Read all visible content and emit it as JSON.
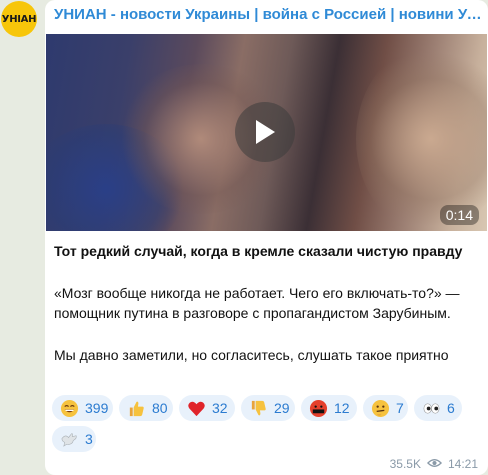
{
  "avatar": {
    "text": "УНІАН"
  },
  "channel": {
    "title": "УНИАН - новости Украины | война с Россией | новини України..."
  },
  "video": {
    "duration": "0:14"
  },
  "message": {
    "title": "Тот редкий случай, когда в кремле сказали чистую правду",
    "quote": "«Мозг вообще никогда не работает. Чего его включать-то?» — помощник путина в разговоре с пропагандистом Зарубиным.",
    "closing": "Мы давно заметили, но согласитесь, слушать такое приятно"
  },
  "reactions": [
    {
      "emoji": "grin-emoji",
      "count": "399"
    },
    {
      "emoji": "thumbs-up-emoji",
      "count": "80"
    },
    {
      "emoji": "red-heart-emoji",
      "count": "32"
    },
    {
      "emoji": "thumbs-down-emoji",
      "count": "29"
    },
    {
      "emoji": "cursing-face-emoji",
      "count": "12"
    },
    {
      "emoji": "thinking-face-emoji",
      "count": "7"
    },
    {
      "emoji": "eyes-emoji",
      "count": "6"
    },
    {
      "emoji": "dove-emoji",
      "count": "3"
    }
  ],
  "footer": {
    "views": "35.5K",
    "time": "14:21"
  },
  "colors": {
    "accent": "#2f8ad6",
    "reaction_bg": "#e8f1fb",
    "avatar_bg": "#f7c60a"
  }
}
